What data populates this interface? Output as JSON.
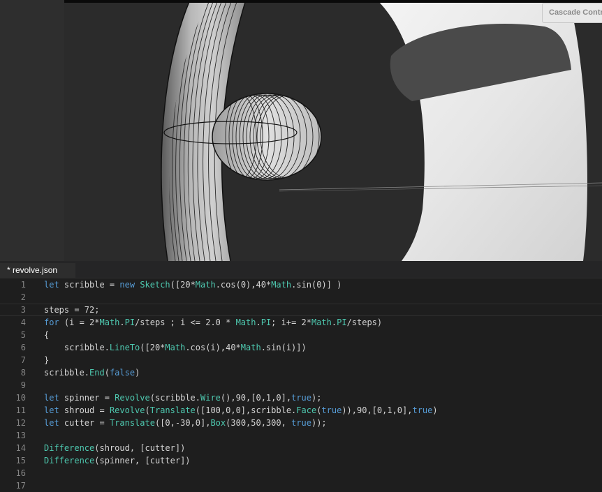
{
  "viewer": {
    "cascade_button": "Cascade Control Panel"
  },
  "editor": {
    "tab_label": "* revolve.json",
    "current_line": 3,
    "lines": [
      {
        "n": "1",
        "t": "let scribble = new Sketch([20*Math.cos(0),40*Math.sin(0)] )"
      },
      {
        "n": "2",
        "t": ""
      },
      {
        "n": "3",
        "t": "steps = 72;"
      },
      {
        "n": "4",
        "t": "for (i = 2*Math.PI/steps ; i <= 2.0 * Math.PI; i+= 2*Math.PI/steps)"
      },
      {
        "n": "5",
        "t": "{"
      },
      {
        "n": "6",
        "t": "    scribble.LineTo([20*Math.cos(i),40*Math.sin(i)])"
      },
      {
        "n": "7",
        "t": "}"
      },
      {
        "n": "8",
        "t": "scribble.End(false)"
      },
      {
        "n": "9",
        "t": ""
      },
      {
        "n": "10",
        "t": "let spinner = Revolve(scribble.Wire(),90,[0,1,0],true);"
      },
      {
        "n": "11",
        "t": "let shroud = Revolve(Translate([100,0,0],scribble.Face(true)),90,[0,1,0],true)"
      },
      {
        "n": "12",
        "t": "let cutter = Translate([0,-30,0],Box(300,50,300, true));"
      },
      {
        "n": "13",
        "t": ""
      },
      {
        "n": "14",
        "t": "Difference(shroud, [cutter])"
      },
      {
        "n": "15",
        "t": "Difference(spinner, [cutter])"
      },
      {
        "n": "16",
        "t": ""
      },
      {
        "n": "17",
        "t": ""
      }
    ]
  }
}
